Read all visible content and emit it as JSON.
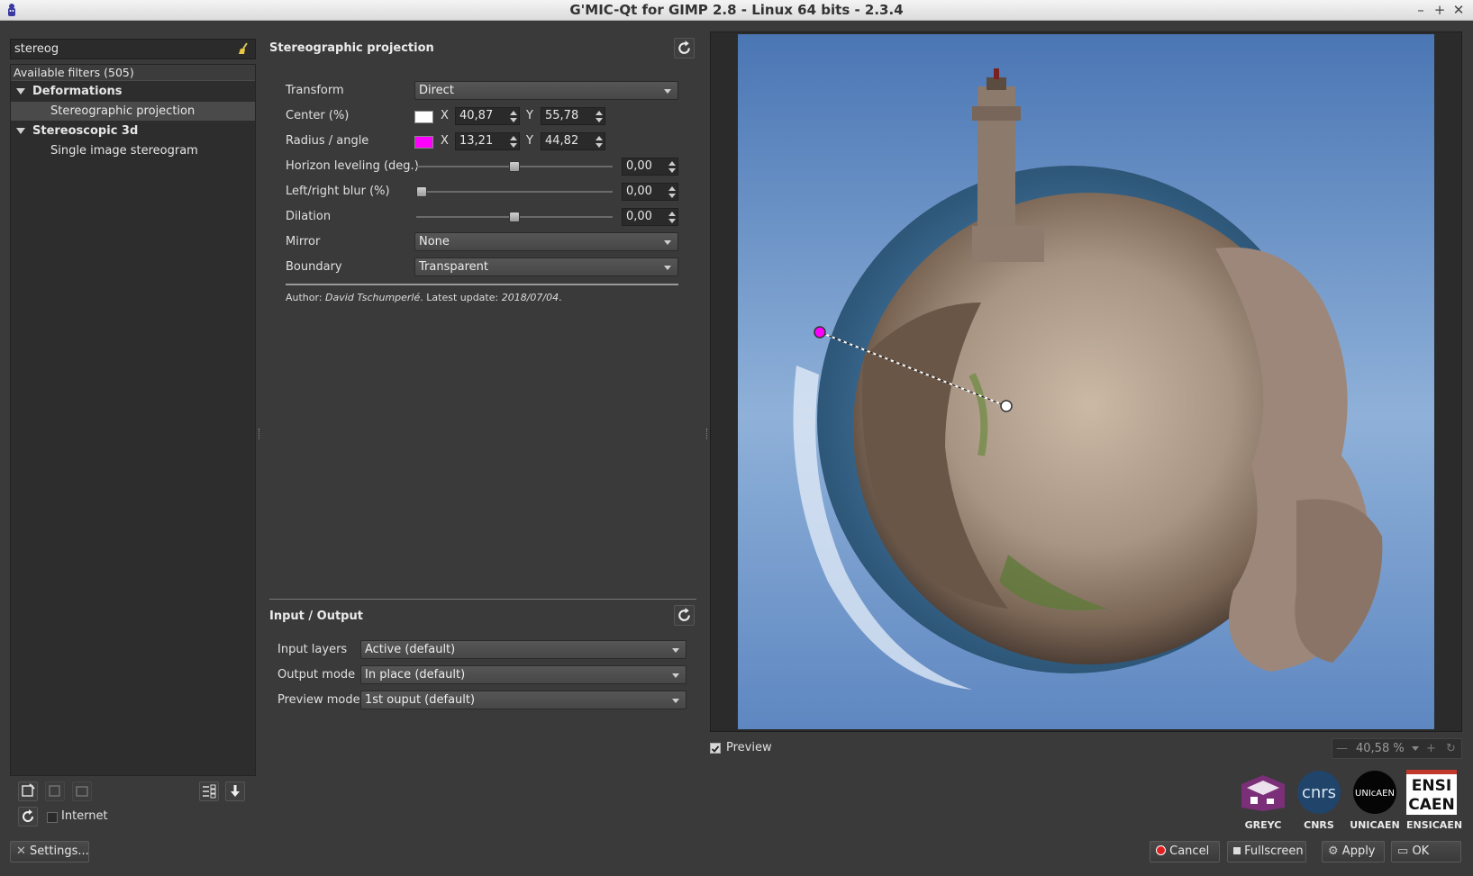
{
  "window": {
    "title": "G'MIC-Qt for GIMP 2.8 - Linux 64 bits - 2.3.4",
    "controls": [
      "–",
      "+",
      "✕"
    ]
  },
  "search": {
    "value": "stereog"
  },
  "filters": {
    "available_label": "Available filters (505)",
    "tree": [
      {
        "label": "Deformations",
        "type": "category"
      },
      {
        "label": "Stereographic projection",
        "type": "item",
        "selected": true
      },
      {
        "label": "Stereoscopic 3d",
        "type": "category"
      },
      {
        "label": "Single image stereogram",
        "type": "item",
        "selected": false
      }
    ]
  },
  "left_bottom": {
    "internet_label": "Internet",
    "internet_checked": false,
    "settings_label": "Settings..."
  },
  "filter_panel": {
    "title": "Stereographic projection",
    "params": {
      "transform": {
        "label": "Transform",
        "value": "Direct"
      },
      "center": {
        "label": "Center (%)",
        "x_label": "X",
        "x": "40,87",
        "y_label": "Y",
        "y": "55,78",
        "color": "#ffffff"
      },
      "radius": {
        "label": "Radius / angle",
        "x_label": "X",
        "x": "13,21",
        "y_label": "Y",
        "y": "44,82",
        "color": "#ff00ff"
      },
      "horizon": {
        "label": "Horizon leveling (deg.)",
        "value": "0,00",
        "position": 0.5
      },
      "blur": {
        "label": "Left/right blur (%)",
        "value": "0,00",
        "position": 0.0
      },
      "dilation": {
        "label": "Dilation",
        "value": "0,00",
        "position": 0.5
      },
      "mirror": {
        "label": "Mirror",
        "value": "None"
      },
      "boundary": {
        "label": "Boundary",
        "value": "Transparent"
      }
    },
    "author_prefix": "Author: ",
    "author_name": "David Tschumperlé",
    "update_prefix": ". Latest update: ",
    "update_date": "2018/07/04",
    "update_suffix": "."
  },
  "io_panel": {
    "title": "Input / Output",
    "input_layers": {
      "label": "Input layers",
      "value": "Active (default)"
    },
    "output_mode": {
      "label": "Output mode",
      "value": "In place (default)"
    },
    "preview_mode": {
      "label": "Preview mode",
      "value": "1st ouput (default)"
    }
  },
  "preview": {
    "checkbox_label": "Preview",
    "checked": true,
    "zoom": "40,58 %"
  },
  "logos": [
    "GREYC",
    "CNRS",
    "UNICAEN",
    "ENSICAEN"
  ],
  "logo_marks": {
    "cnrs": "cnrs",
    "unicaen": "UNIcAEN",
    "ensi_top": "ENSI",
    "ensi_bottom": "CAEN"
  },
  "actions": {
    "cancel": "Cancel",
    "fullscreen": "Fullscreen",
    "apply": "Apply",
    "ok": "OK"
  },
  "colors": {
    "accent_magenta": "#ff00ff",
    "bg": "#3a3a3a",
    "panel": "#2d2d2d"
  }
}
